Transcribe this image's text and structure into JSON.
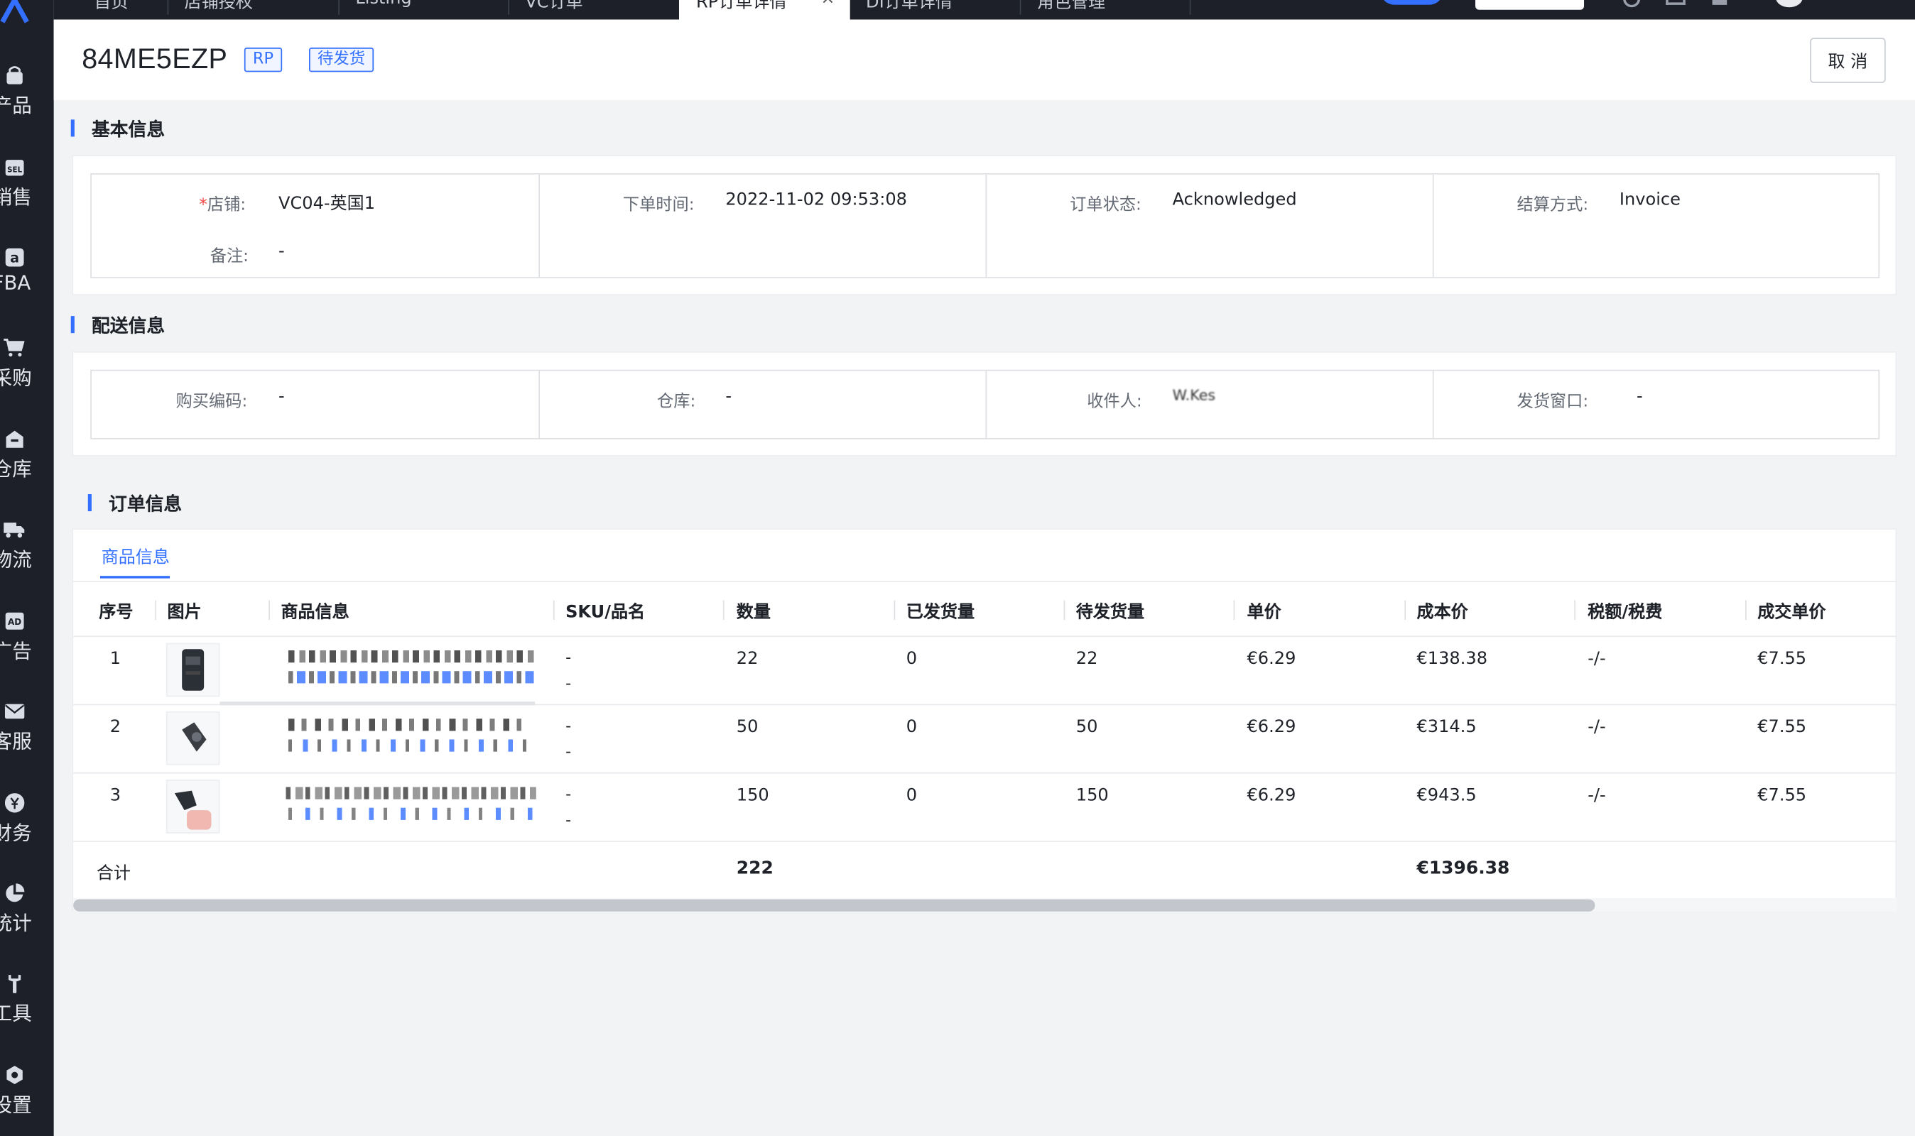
{
  "top_tabs": [
    {
      "label": "首页"
    },
    {
      "label": "店铺授权"
    },
    {
      "label": "Listing"
    },
    {
      "label": "VC订单"
    },
    {
      "label": "RP订单详情"
    },
    {
      "label": "DI订单详情"
    },
    {
      "label": "角色管理"
    }
  ],
  "sidebar": {
    "items": [
      {
        "label": "产品",
        "icon": "bag-icon"
      },
      {
        "label": "销售",
        "icon": "sell-icon"
      },
      {
        "label": "FBA",
        "icon": "amazon-icon"
      },
      {
        "label": "采购",
        "icon": "cart-icon"
      },
      {
        "label": "仓库",
        "icon": "warehouse-icon"
      },
      {
        "label": "物流",
        "icon": "truck-icon"
      },
      {
        "label": "广告",
        "icon": "ad-icon"
      },
      {
        "label": "客服",
        "icon": "mail-icon"
      },
      {
        "label": "财务",
        "icon": "yen-icon"
      },
      {
        "label": "统计",
        "icon": "pie-chart-icon"
      },
      {
        "label": "工具",
        "icon": "wrench-icon"
      },
      {
        "label": "设置",
        "icon": "hexagon-gear-icon"
      }
    ]
  },
  "header": {
    "order_no": "84ME5EZP",
    "badge_type": "RP",
    "badge_status": "待发货",
    "cancel_label": "取 消"
  },
  "basic": {
    "title": "基本信息",
    "store_label": "店铺:",
    "store_value": "VC04-英国1",
    "remark_label": "备注:",
    "remark_value": "-",
    "order_time_label": "下单时间:",
    "order_time_value": "2022-11-02 09:53:08",
    "status_label": "订单状态:",
    "status_value": "Acknowledged",
    "settle_label": "结算方式:",
    "settle_value": "Invoice"
  },
  "shipping": {
    "title": "配送信息",
    "purchase_code_label": "购买编码:",
    "purchase_code_value": "-",
    "warehouse_label": "仓库:",
    "warehouse_value": "-",
    "receiver_label": "收件人:",
    "receiver_value": "W.Kes",
    "window_label": "发货窗口:",
    "window_value": "-"
  },
  "order": {
    "title": "订单信息",
    "tab_label": "商品信息",
    "columns": [
      "序号",
      "图片",
      "商品信息",
      "SKU/品名",
      "数量",
      "已发货量",
      "待发货量",
      "单价",
      "成本价",
      "税额/税费",
      "成交单价"
    ],
    "rows": [
      {
        "no": "1",
        "sku": "-",
        "name": "-",
        "qty": "22",
        "shipped": "0",
        "pending": "22",
        "price": "€6.29",
        "cost": "€138.38",
        "tax": "-/-",
        "deal": "€7.55"
      },
      {
        "no": "2",
        "sku": "-",
        "name": "-",
        "qty": "50",
        "shipped": "0",
        "pending": "50",
        "price": "€6.29",
        "cost": "€314.5",
        "tax": "-/-",
        "deal": "€7.55"
      },
      {
        "no": "3",
        "sku": "-",
        "name": "-",
        "qty": "150",
        "shipped": "0",
        "pending": "150",
        "price": "€6.29",
        "cost": "€943.5",
        "tax": "-/-",
        "deal": "€7.55"
      }
    ],
    "total_label": "合计",
    "total_qty": "222",
    "total_cost": "€1396.38"
  },
  "colors": {
    "accent": "#3370ff",
    "sidebar_bg": "#1d2029",
    "danger": "#f54a45"
  }
}
